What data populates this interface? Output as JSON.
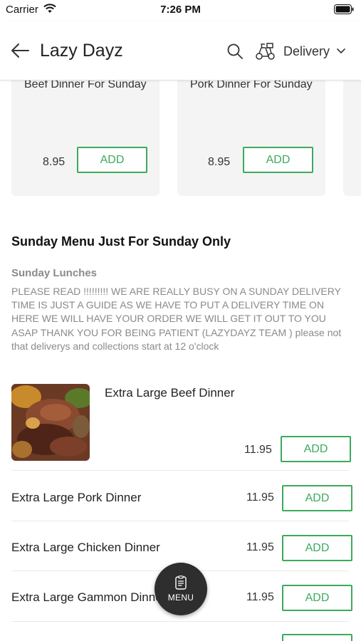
{
  "status_bar": {
    "carrier": "Carrier",
    "time": "7:26 PM"
  },
  "header": {
    "title": "Lazy Dayz",
    "back_icon": "arrow-left-icon",
    "search_icon": "search-icon",
    "delivery_icon": "scooter-icon",
    "delivery_label": "Delivery"
  },
  "featured_cards": [
    {
      "name": "Beef Dinner For Sunday",
      "price": "8.95",
      "add_label": "ADD"
    },
    {
      "name": "Pork Dinner For Sunday",
      "price": "8.95",
      "add_label": "ADD"
    }
  ],
  "section": {
    "title": "Sunday Menu Just For Sunday Only",
    "subtitle": "Sunday Lunches",
    "description": "PLEASE READ !!!!!!!!! WE ARE REALLY BUSY ON A SUNDAY DELIVERY TIME IS JUST A GUIDE AS WE HAVE TO PUT A DELIVERY TIME ON HERE WE WILL HAVE YOUR ORDER WE WILL GET IT OUT TO YOU ASAP THANK YOU FOR BEING PATIENT (LAZYDAYZ TEAM ) please not that deliverys and collections start at 12 o'clock"
  },
  "featured_item": {
    "name": "Extra Large Beef Dinner",
    "price": "11.95",
    "add_label": "ADD"
  },
  "menu_items": [
    {
      "name": "Extra Large Pork Dinner",
      "price": "11.95",
      "add_label": "ADD"
    },
    {
      "name": "Extra Large Chicken Dinner",
      "price": "11.95",
      "add_label": "ADD"
    },
    {
      "name": "Extra Large Gammon Dinner",
      "price": "11.95",
      "add_label": "ADD"
    }
  ],
  "menu_button": {
    "label": "MENU",
    "icon": "menu-clipboard-icon"
  },
  "colors": {
    "accent": "#3daa5c",
    "fab": "#2e2e2e",
    "muted_text": "#8a8a8a"
  }
}
